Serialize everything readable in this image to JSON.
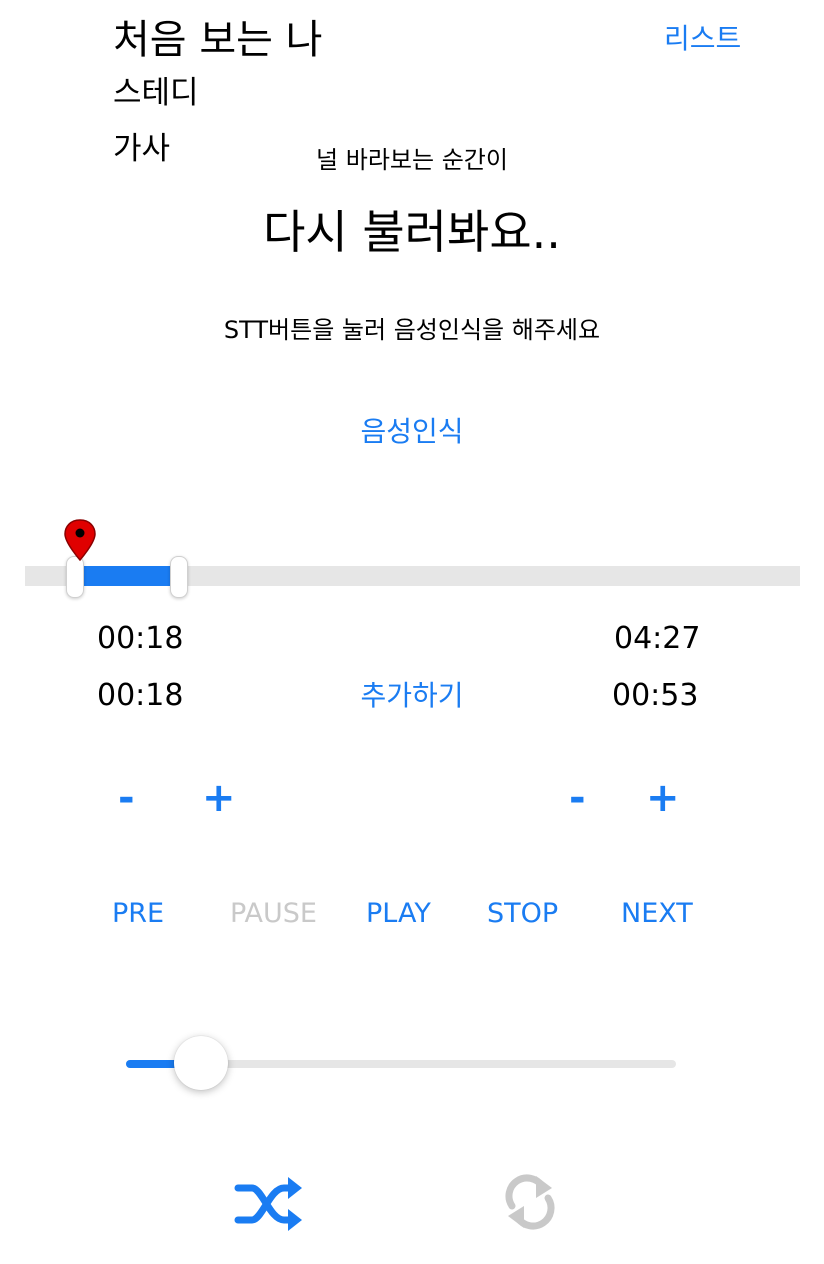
{
  "header": {
    "song_title": "처음 보는 나",
    "list_link": "리스트",
    "artist": "스테디",
    "lyrics_label": "가사"
  },
  "lyrics": {
    "previous_line": "널 바라보는 순간이",
    "retry_prompt": "다시 불러봐요..",
    "instruction": "STT버튼을 눌러 음성인식을 해주세요",
    "stt_button": "음성인식"
  },
  "range_slider": {
    "start_fraction": 0.07,
    "end_fraction": 0.19,
    "marker_icon": "map-pin-icon"
  },
  "times": {
    "current": "00:18",
    "total": "04:27",
    "loop_start": "00:18",
    "loop_end": "00:53",
    "add_button": "추가하기"
  },
  "adjust_buttons": {
    "start_minus": "-",
    "start_plus": "+",
    "end_minus": "-",
    "end_plus": "+"
  },
  "controls": {
    "pre": "PRE",
    "pause": "PAUSE",
    "play": "PLAY",
    "stop": "STOP",
    "next": "NEXT"
  },
  "volume": {
    "level_fraction": 0.14
  },
  "bottom_icons": {
    "shuffle": "shuffle-icon",
    "repeat": "repeat-icon"
  },
  "colors": {
    "accent": "#1a7cf2",
    "disabled": "#c9c9c9",
    "track": "#e6e6e6",
    "marker": "#e00000"
  }
}
